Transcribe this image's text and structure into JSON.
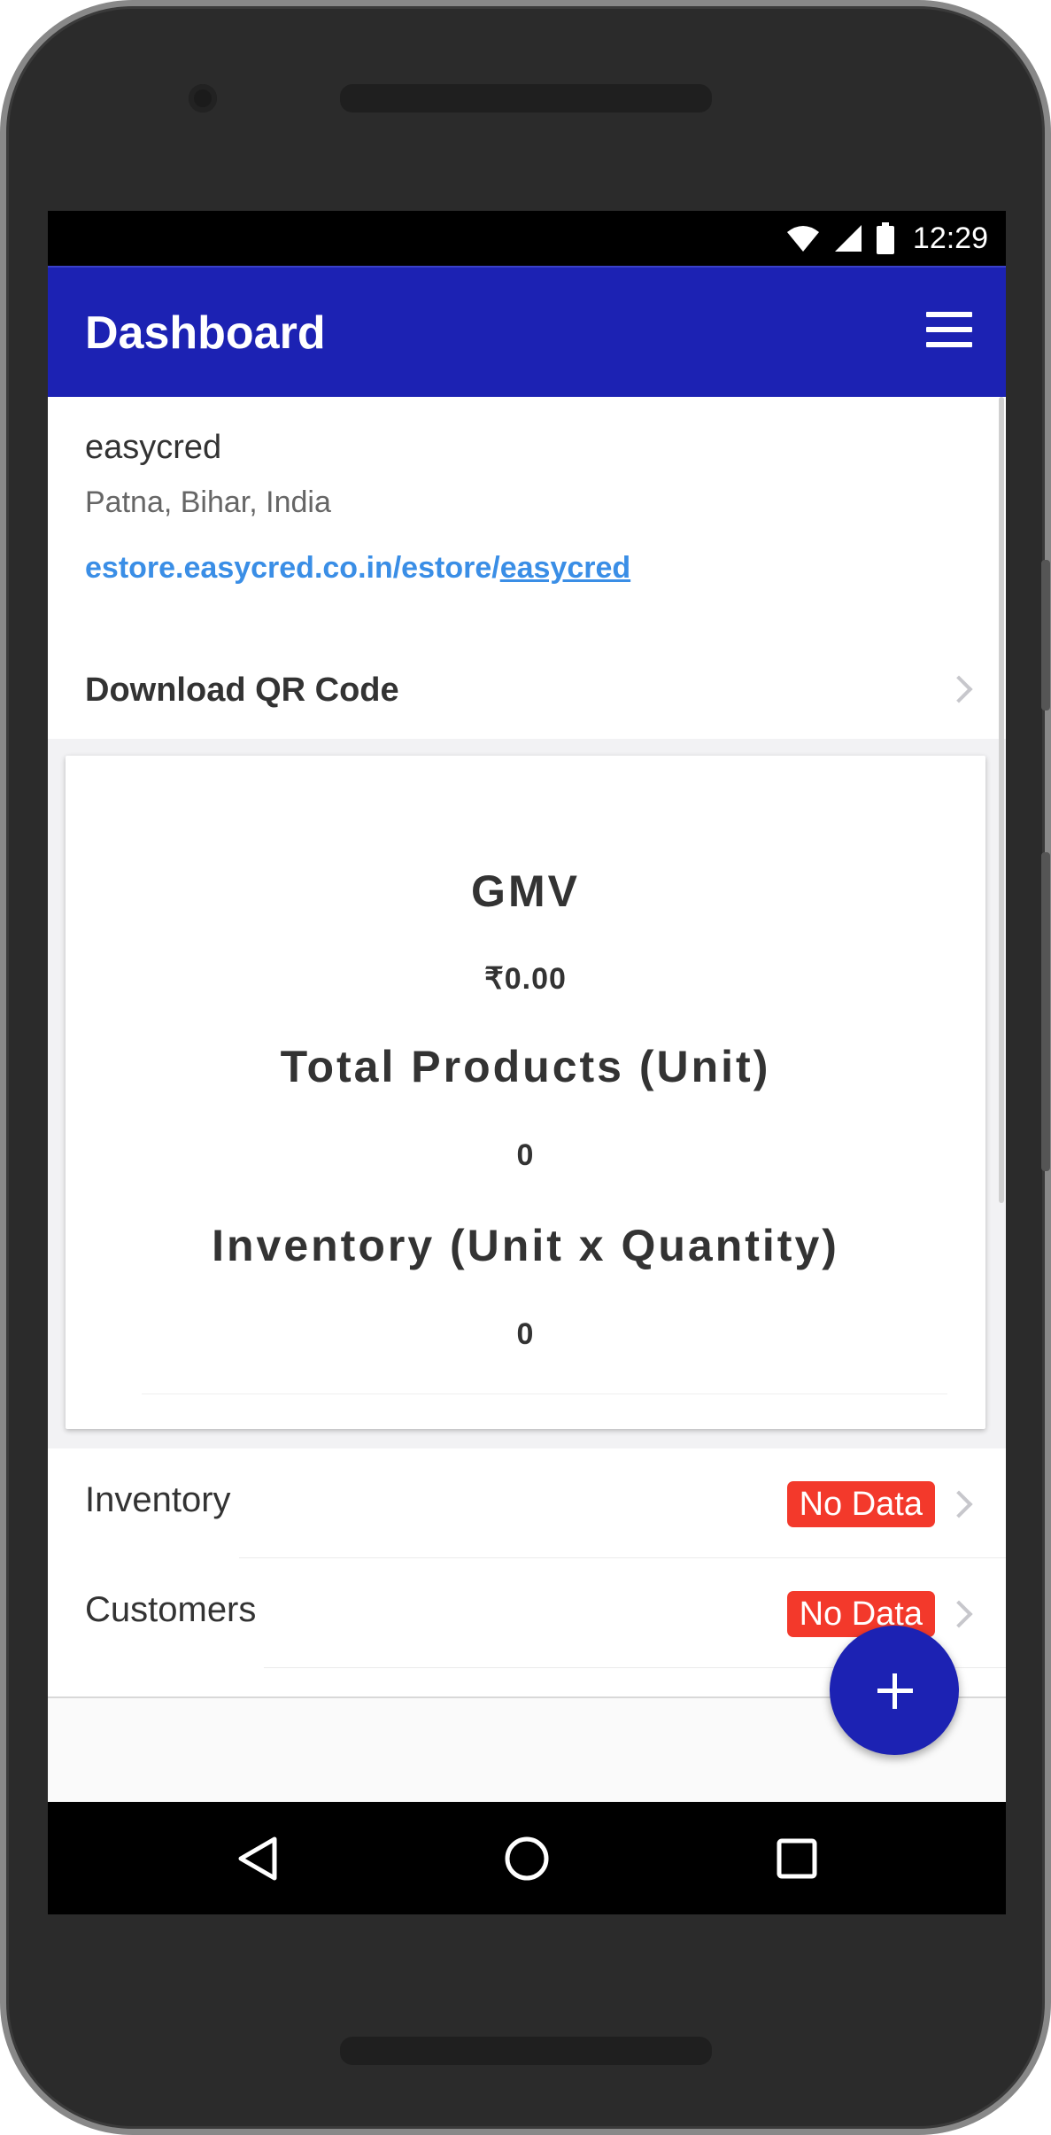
{
  "status_bar": {
    "time": "12:29",
    "icons": [
      "wifi-icon",
      "cell-signal-icon",
      "battery-icon"
    ]
  },
  "app_bar": {
    "title": "Dashboard",
    "menu_icon": "hamburger-menu-icon"
  },
  "store": {
    "name": "easycred",
    "location": "Patna, Bihar, India",
    "link_prefix": "estore.easycred.co.in/estore/",
    "link_slug": "easycred",
    "qr_label": "Download QR Code"
  },
  "stats": {
    "gmv_label": "GMV",
    "gmv_value": "₹0.00",
    "products_label": "Total Products (Unit)",
    "products_value": "0",
    "inventory_label": "Inventory (Unit x Quantity)",
    "inventory_value": "0"
  },
  "list": [
    {
      "label": "Inventory",
      "badge": "No Data"
    },
    {
      "label": "Customers",
      "badge": "No Data"
    }
  ],
  "fab": {
    "icon": "plus-icon"
  },
  "nav": [
    "back-icon",
    "home-icon",
    "recents-icon"
  ],
  "colors": {
    "primary": "#1c22b3",
    "link": "#3a8ee6",
    "badge": "#f3392b"
  }
}
